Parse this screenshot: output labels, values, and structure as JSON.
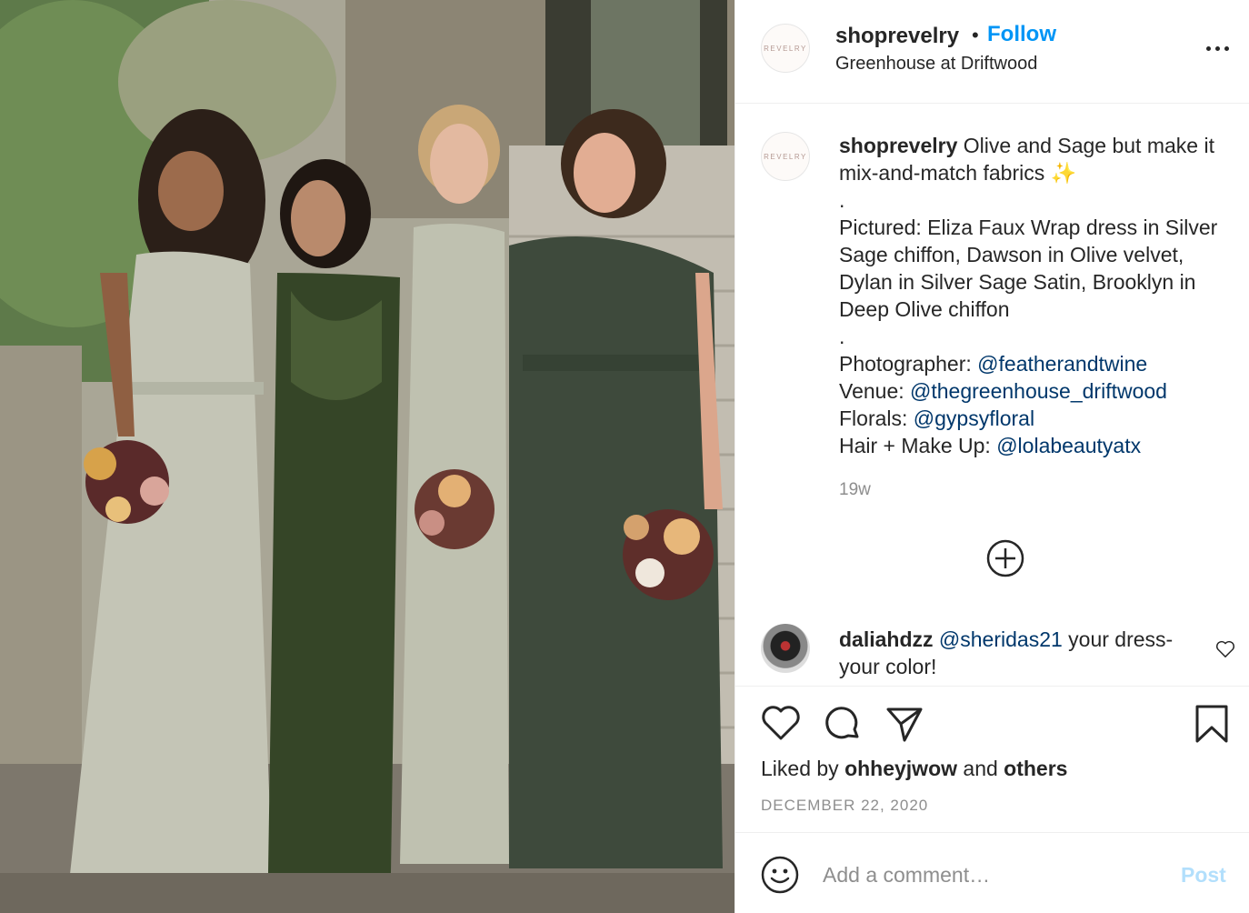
{
  "post": {
    "username": "shoprevelry",
    "dot": "•",
    "follow_label": "Follow",
    "location": "Greenhouse at Driftwood",
    "avatar_text": "REVELRY"
  },
  "caption": {
    "username": "shoprevelry",
    "line1": "Olive and Sage but make it mix-and-match fabrics",
    "sparkle": "✨",
    "sep1": ".",
    "pictured": "Pictured: Eliza Faux Wrap dress in Silver Sage chiffon, Dawson in Olive velvet, Dylan in Silver Sage Satin, Brooklyn in Deep Olive chiffon",
    "sep2": ".",
    "credits": [
      {
        "label": "Photographer: ",
        "handle": "@featherandtwine"
      },
      {
        "label": "Venue: ",
        "handle": "@thegreenhouse_driftwood"
      },
      {
        "label": "Florals: ",
        "handle": "@gypsyfloral"
      },
      {
        "label": "Hair + Make Up: ",
        "handle": "@lolabeautyatx"
      }
    ],
    "time_ago": "19w"
  },
  "comment": {
    "username": "daliahdzz",
    "mention": "@sheridas21",
    "text": " your dress-your color!"
  },
  "actions": {
    "liked_prefix": "Liked by ",
    "liked_user": "ohheyjwow",
    "liked_and": " and ",
    "liked_others": "others",
    "date": "DECEMBER 22, 2020"
  },
  "add_comment": {
    "placeholder": "Add a comment…",
    "post_label": "Post"
  },
  "colors": {
    "accent": "#0095f6",
    "link": "#00376b",
    "muted": "#8e8e8e",
    "post_disabled": "#b2dffc"
  }
}
